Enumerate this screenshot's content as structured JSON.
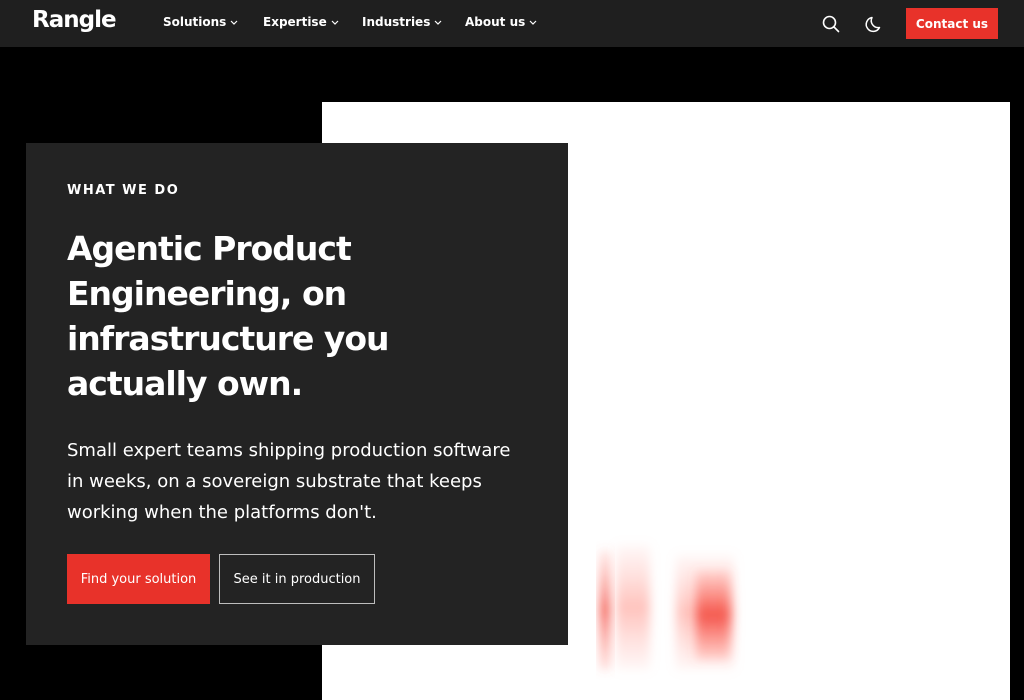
{
  "header": {
    "logo": "Rangle",
    "nav": [
      {
        "label": "Solutions"
      },
      {
        "label": "Expertise"
      },
      {
        "label": "Industries"
      },
      {
        "label": "About us"
      }
    ],
    "icons": [
      "search-icon",
      "moon-icon"
    ],
    "contact_label": "Contact us"
  },
  "hero": {
    "eyebrow": "WHAT WE DO",
    "title": "Agentic Product Engineering, on infrastructure you actually own.",
    "subtitle": "Small expert teams shipping production software in weeks, on a sovereign substrate that keeps working when the platforms don't.",
    "primary_cta": "Find your solution",
    "secondary_cta": "See it in production"
  },
  "colors": {
    "accent": "#e8322a",
    "topbar": "#1f1f1f",
    "card": "#232323",
    "background": "#000000",
    "panel": "#ffffff"
  }
}
